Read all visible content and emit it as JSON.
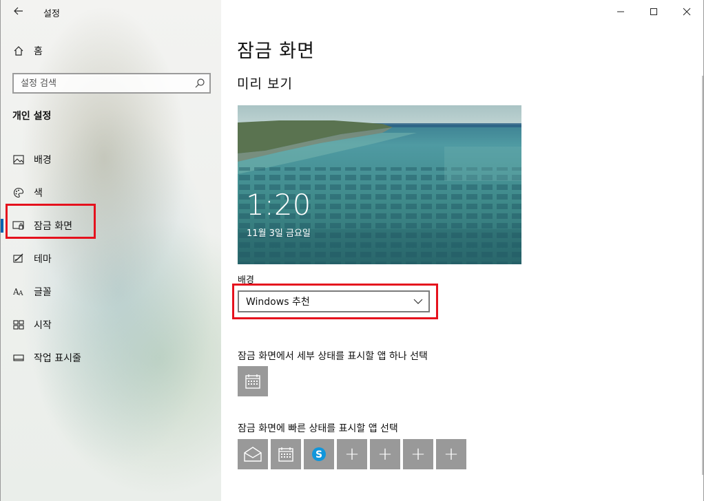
{
  "window": {
    "app_title": "설정",
    "controls": [
      "minimize-icon",
      "maximize-icon",
      "close-icon"
    ]
  },
  "sidebar": {
    "home_label": "홈",
    "search_placeholder": "설정 검색",
    "section_heading": "개인 설정",
    "items": [
      {
        "label": "배경",
        "icon": "picture-icon"
      },
      {
        "label": "색",
        "icon": "palette-icon"
      },
      {
        "label": "잠금 화면",
        "icon": "lock-screen-icon",
        "active": true
      },
      {
        "label": "테마",
        "icon": "theme-icon"
      },
      {
        "label": "글꼴",
        "icon": "font-icon"
      },
      {
        "label": "시작",
        "icon": "start-icon"
      },
      {
        "label": "작업 표시줄",
        "icon": "taskbar-icon"
      }
    ]
  },
  "main": {
    "page_title": "잠금 화면",
    "preview_heading": "미리 보기",
    "preview_time": "1:20",
    "preview_date": "11월 3일 금요일",
    "background_label": "배경",
    "background_value": "Windows 추천",
    "detail_heading": "잠금 화면에서 세부 상태를 표시할 앱 하나 선택",
    "detail_app": "calendar-icon",
    "quick_heading": "잠금 화면에 빠른 상태를 표시할 앱 선택",
    "quick_apps": [
      "mail-icon",
      "calendar-icon",
      "skype-icon",
      "plus-icon",
      "plus-icon",
      "plus-icon",
      "plus-icon"
    ],
    "plus_label": "+"
  },
  "colors": {
    "accent": "#0063b1",
    "highlight": "#e5111d",
    "tile": "#999999"
  }
}
